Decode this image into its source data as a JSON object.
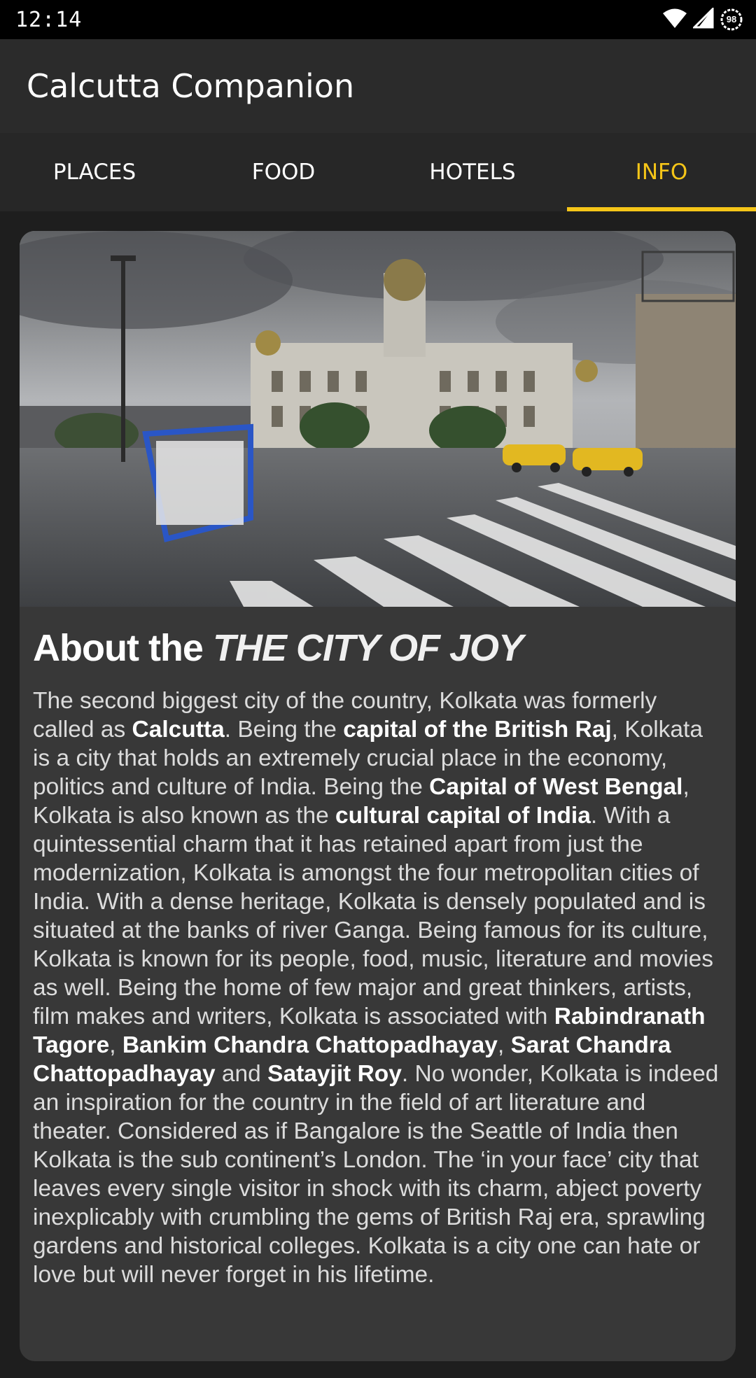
{
  "status_bar": {
    "time": "12:14",
    "icons": [
      "wifi-icon",
      "signal-icon",
      "battery-icon"
    ],
    "battery_level": "98"
  },
  "app_bar": {
    "title": "Calcutta Companion"
  },
  "tabs": [
    {
      "label": "PLACES",
      "active": false
    },
    {
      "label": "FOOD",
      "active": false
    },
    {
      "label": "HOTELS",
      "active": false
    },
    {
      "label": "INFO",
      "active": true
    }
  ],
  "colors": {
    "accent": "#f5c518",
    "app_bar": "#2b2b2b",
    "background": "#1e1e1e",
    "card": "#383838"
  },
  "article": {
    "heading_prefix": "About the ",
    "heading_emphasis": "THE CITY OF JOY",
    "paragraph": [
      {
        "text": "The second biggest city of the country, Kolkata was formerly called as ",
        "bold": false
      },
      {
        "text": "Calcutta",
        "bold": true
      },
      {
        "text": ". Being the ",
        "bold": false
      },
      {
        "text": "capital of the British Raj",
        "bold": true
      },
      {
        "text": ", Kolkata is a city that holds an extremely crucial place in the economy, politics and culture of India. Being the ",
        "bold": false
      },
      {
        "text": "Capital of West Bengal",
        "bold": true
      },
      {
        "text": ", Kolkata is also known as the ",
        "bold": false
      },
      {
        "text": "cultural capital of India",
        "bold": true
      },
      {
        "text": ". With a quintessential charm that it has retained apart from just the modernization, Kolkata is amongst the four metropolitan cities of India. With a dense heritage, Kolkata is densely populated and is situated at the banks of river Ganga. Being famous for its culture, Kolkata is known for its people, food, music, literature and movies as well. Being the home of few major and great thinkers, artists, film makes and writers, Kolkata is associated with ",
        "bold": false
      },
      {
        "text": "Rabindranath Tagore",
        "bold": true
      },
      {
        "text": ", ",
        "bold": false
      },
      {
        "text": "Bankim Chandra Chattopadhayay",
        "bold": true
      },
      {
        "text": ", ",
        "bold": false
      },
      {
        "text": "Sarat Chandra Chattopadhayay",
        "bold": true
      },
      {
        "text": " and ",
        "bold": false
      },
      {
        "text": "Satayjit Roy",
        "bold": true
      },
      {
        "text": ". No wonder, Kolkata is indeed an inspiration for the country in the field of art literature and theater. Considered as if Bangalore is the Seattle of India then Kolkata is the sub continent’s London. The ‘in your face’ city that leaves every single visitor in shock with its charm, abject poverty inexplicably with crumbling the gems of British Raj era, sprawling gardens and historical colleges. Kolkata is a city one can hate or love but will never forget in his lifetime.",
        "bold": false
      }
    ]
  }
}
